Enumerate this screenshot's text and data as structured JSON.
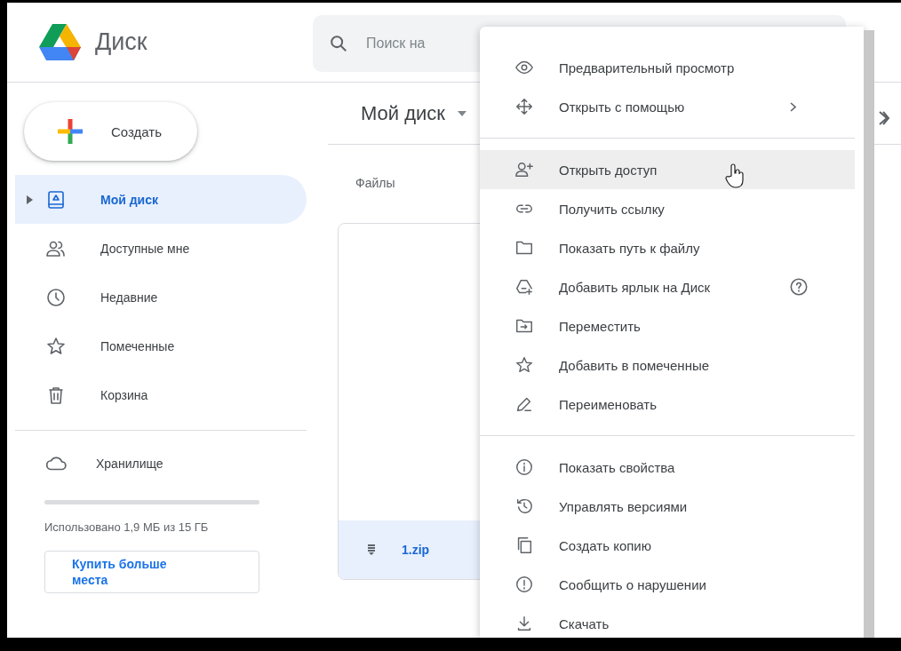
{
  "app": {
    "title": "Диск"
  },
  "search": {
    "placeholder": "Поиск на"
  },
  "create_button": {
    "label": "Создать"
  },
  "sidebar": {
    "items": [
      {
        "label": "Мой диск",
        "selected": true,
        "expandable": true
      },
      {
        "label": "Доступные мне",
        "selected": false,
        "expandable": false
      },
      {
        "label": "Недавние",
        "selected": false,
        "expandable": false
      },
      {
        "label": "Помеченные",
        "selected": false,
        "expandable": false
      },
      {
        "label": "Корзина",
        "selected": false,
        "expandable": false
      }
    ],
    "storage": {
      "label": "Хранилище",
      "level": 0,
      "usage": "Использовано 1,9 МБ из 15 ГБ",
      "buy_button": "Купить больше места"
    }
  },
  "main": {
    "breadcrumb": "Мой диск",
    "section_title": "Файлы",
    "files": [
      {
        "name": "1.zip",
        "selected": true
      }
    ]
  },
  "context_menu": {
    "groups": [
      {
        "items": [
          {
            "label": "Предварительный просмотр",
            "selected": false,
            "submenu": false,
            "help": false
          },
          {
            "label": "Открыть с помощью",
            "selected": false,
            "submenu": true,
            "help": false
          }
        ]
      },
      {
        "items": [
          {
            "label": "Открыть доступ",
            "selected": true,
            "submenu": false,
            "help": false
          },
          {
            "label": "Получить ссылку",
            "selected": false,
            "submenu": false,
            "help": false
          },
          {
            "label": "Показать путь к файлу",
            "selected": false,
            "submenu": false,
            "help": false
          },
          {
            "label": "Добавить ярлык на Диск",
            "selected": false,
            "submenu": false,
            "help": true
          },
          {
            "label": "Переместить",
            "selected": false,
            "submenu": false,
            "help": false
          },
          {
            "label": "Добавить в помеченные",
            "selected": false,
            "submenu": false,
            "help": false
          },
          {
            "label": "Переименовать",
            "selected": false,
            "submenu": false,
            "help": false
          }
        ]
      },
      {
        "items": [
          {
            "label": "Показать свойства",
            "selected": false,
            "submenu": false,
            "help": false
          },
          {
            "label": "Управлять версиями",
            "selected": false,
            "submenu": false,
            "help": false
          },
          {
            "label": "Создать копию",
            "selected": false,
            "submenu": false,
            "help": false
          },
          {
            "label": "Сообщить о нарушении",
            "selected": false,
            "submenu": false,
            "help": false
          },
          {
            "label": "Скачать",
            "selected": false,
            "submenu": false,
            "help": false
          }
        ]
      }
    ]
  }
}
